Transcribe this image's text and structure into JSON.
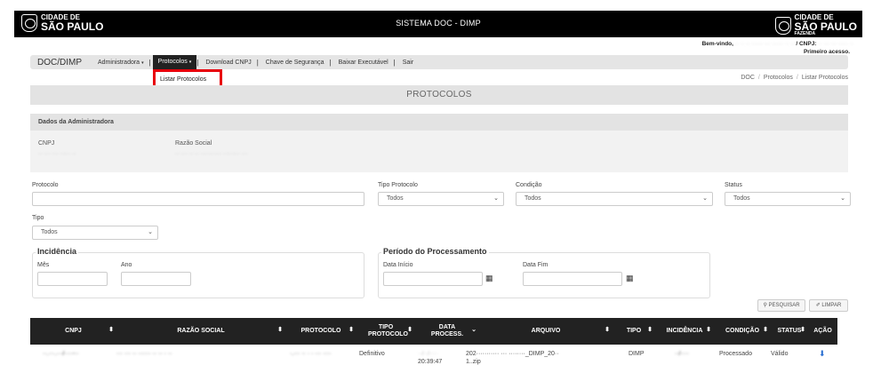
{
  "header": {
    "logo_left": {
      "line1": "CIDADE DE",
      "line2": "SÃO PAULO"
    },
    "title": "SISTEMA DOC - DIMP",
    "logo_right": {
      "line1": "CIDADE DE",
      "line2": "SÃO PAULO",
      "line3": "FAZENDA"
    }
  },
  "user": {
    "welcome_label": "Bem-vindo,",
    "welcome_name": "·· ·· ·· ······ ··· ······ ·· ··",
    "cnpj_label": "/ CNPJ:",
    "cnpj_value": "·· ··· ··· ····· ··",
    "first_access": "Primeiro acesso."
  },
  "nav": {
    "brand": "DOC/DIMP",
    "items": [
      {
        "label": "Administradora",
        "caret": "▾"
      },
      {
        "label": "Protocolos",
        "caret": "▾"
      },
      {
        "label": "Download CNPJ"
      },
      {
        "label": "Chave de Segurança"
      },
      {
        "label": "Baixar Executável"
      },
      {
        "label": "Sair"
      }
    ],
    "separator": "|",
    "dropdown_item": "Listar Protocolos"
  },
  "breadcrumb": [
    "DOC",
    "Protocolos",
    "Listar Protocolos"
  ],
  "breadcrumb_sep": "/",
  "page_title": "PROTOCOLOS",
  "admin": {
    "heading": "Dados da Administradora",
    "cnpj_label": "CNPJ",
    "cnpj_value": "·· ··· ··· ····· ··",
    "razao_label": "Razão Social",
    "razao_value": "·· ··· ·· ·· ·········· ········ ···"
  },
  "filters": {
    "protocolo_label": "Protocolo",
    "protocolo_value": "",
    "tipo_protocolo_label": "Tipo Protocolo",
    "tipo_protocolo_value": "Todos",
    "condicao_label": "Condição",
    "condicao_value": "Todos",
    "status_label": "Status",
    "status_value": "Todos",
    "tipo_label": "Tipo",
    "tipo_value": "Todos",
    "incidencia_legend": "Incidência",
    "mes_label": "Mês",
    "ano_label": "Ano",
    "periodo_legend": "Período do Processamento",
    "data_inicio_label": "Data Início",
    "data_fim_label": "Data Fim",
    "chevron": "⌄",
    "calendar_glyph": "▦"
  },
  "buttons": {
    "search": "⚲ PESQUISAR",
    "clear": "✐ LIMPAR"
  },
  "table": {
    "columns": [
      {
        "label": "CNPJ",
        "sort": "⬍"
      },
      {
        "label": "RAZÃO SOCIAL",
        "sort": "⬍"
      },
      {
        "label": "PROTOCOLO",
        "sort": "⬍"
      },
      {
        "label": "TIPO PROTOCOLO",
        "sort": "⬍"
      },
      {
        "label": "DATA PROCESS.",
        "sort": "⌄"
      },
      {
        "label": "ARQUIVO",
        "sort": "⬍"
      },
      {
        "label": "TIPO",
        "sort": "⬍"
      },
      {
        "label": "INCIDÊNCIA",
        "sort": "⬍"
      },
      {
        "label": "CONDIÇÃO",
        "sort": "⬍"
      },
      {
        "label": "STATUS",
        "sort": "⬍"
      },
      {
        "label": "AÇÃO",
        "sort": ""
      }
    ],
    "rows": [
      {
        "cnpj": "··.···.···/····-··",
        "razao": "··· ··· ·· ······ ·· ·· · ··",
        "protocolo": "·.··· ·· · · ··· ····",
        "tipo_protocolo": "Definitivo",
        "data_line1": "··/··/····",
        "data_line2": "20:39:47",
        "arquivo_line1": "202··········· ··· ········_DIMP_20··",
        "arquivo_line2": "1..zip",
        "tipo": "DIMP",
        "incidencia": "··/····",
        "condicao": "Processado",
        "status": "Válido",
        "acao_icon": "⬇"
      }
    ]
  },
  "colors": {
    "topbar": "#000000",
    "highlight_border": "#e8000b",
    "table_header": "#222222",
    "action_icon": "#2a6fd1"
  }
}
